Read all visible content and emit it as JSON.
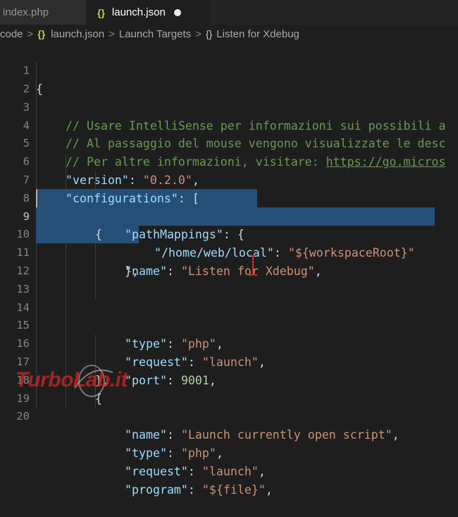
{
  "tabs": [
    {
      "label": "index.php",
      "active": false
    },
    {
      "label": "launch.json",
      "active": true,
      "icon": "json-braces-icon",
      "modified": true
    }
  ],
  "breadcrumb": {
    "items": [
      "code",
      "launch.json",
      "Launch Targets",
      "Listen for Xdebug"
    ],
    "separator": ">"
  },
  "editor": {
    "line_numbers": [
      "1",
      "2",
      "3",
      "4",
      "5",
      "6",
      "7",
      "8",
      "9",
      "10",
      "11",
      "12",
      "13",
      "14",
      "15",
      "16",
      "17",
      "18",
      "19",
      "20"
    ],
    "current_line": "9",
    "lines": {
      "l1": {
        "brace": "{"
      },
      "l2": {
        "comment": "// Usare IntelliSense per informazioni sui possibili a"
      },
      "l3": {
        "comment": "// Al passaggio del mouse vengono visualizzate le desc"
      },
      "l4": {
        "comment": "// Per altre informazioni, visitare: ",
        "link": "https://go.micros"
      },
      "l5": {
        "key": "\"version\"",
        "colon": ": ",
        "value": "\"0.2.0\"",
        "trail": ","
      },
      "l6": {
        "key": "\"configurations\"",
        "colon": ": ",
        "trail": "["
      },
      "l7": {
        "brace": "{"
      },
      "l8": {
        "key": "\"name\"",
        "colon": ": ",
        "value": "\"Listen for Xdebug\"",
        "trail": ","
      },
      "l9": {
        "key": "\"pathMappings\"",
        "colon": ": ",
        "trail": "{"
      },
      "l10": {
        "key": "\"/home/web/local\"",
        "colon": ": ",
        "value": "\"${workspaceRoot}\""
      },
      "l11": {
        "brace": "},"
      },
      "l12": {
        "key": "\"type\"",
        "colon": ": ",
        "value": "\"php\"",
        "trail": ","
      },
      "l13": {
        "key": "\"request\"",
        "colon": ": ",
        "value": "\"launch\"",
        "trail": ","
      },
      "l14": {
        "key": "\"port\"",
        "colon": ": ",
        "value": "9001",
        "trail": ","
      },
      "l15": {
        "brace": "},"
      },
      "l16": {
        "brace": "{"
      },
      "l17": {
        "key": "\"name\"",
        "colon": ": ",
        "value": "\"Launch currently open script\"",
        "trail": ","
      },
      "l18": {
        "key": "\"type\"",
        "colon": ": ",
        "value": "\"php\"",
        "trail": ","
      },
      "l19": {
        "key": "\"request\"",
        "colon": ": ",
        "value": "\"launch\"",
        "trail": ","
      },
      "l20": {
        "key": "\"program\"",
        "colon": ": ",
        "value": "\"${file}\"",
        "trail": ","
      }
    }
  },
  "watermark": {
    "text": "TurboLab.it"
  },
  "colors": {
    "background": "#1e1e1e",
    "selection": "#264f78",
    "key": "#9cdcfe",
    "string": "#ce9178",
    "comment": "#6a9955",
    "number": "#b5cea8",
    "json_icon": "#cbcb41"
  }
}
